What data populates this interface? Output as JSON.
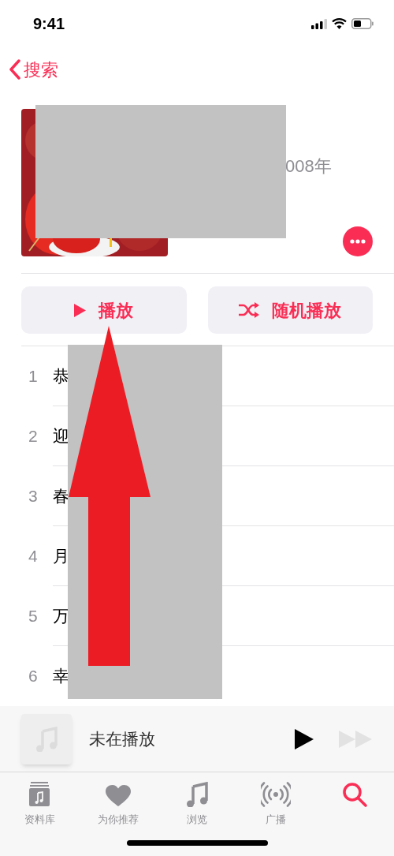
{
  "status_bar": {
    "time": "9:41"
  },
  "nav": {
    "back_label": "搜索"
  },
  "album": {
    "meta": "008年"
  },
  "actions": [
    {
      "kind": "play",
      "label": "播放"
    },
    {
      "kind": "shuffle",
      "label": "随机播放"
    }
  ],
  "tracks": [
    {
      "number": "1",
      "title": "恭"
    },
    {
      "number": "2",
      "title": "迎"
    },
    {
      "number": "3",
      "title": "春"
    },
    {
      "number": "4",
      "title": "月"
    },
    {
      "number": "5",
      "title": "万"
    },
    {
      "number": "6",
      "title": "幸"
    }
  ],
  "mini_player": {
    "title": "未在播放"
  },
  "tabs": [
    {
      "kind": "library",
      "label": "资料库",
      "selected": false
    },
    {
      "kind": "foryou",
      "label": "为你推荐",
      "selected": false
    },
    {
      "kind": "browse",
      "label": "浏览",
      "selected": false
    },
    {
      "kind": "radio",
      "label": "广播",
      "selected": false
    },
    {
      "kind": "search",
      "selected": true
    }
  ]
}
